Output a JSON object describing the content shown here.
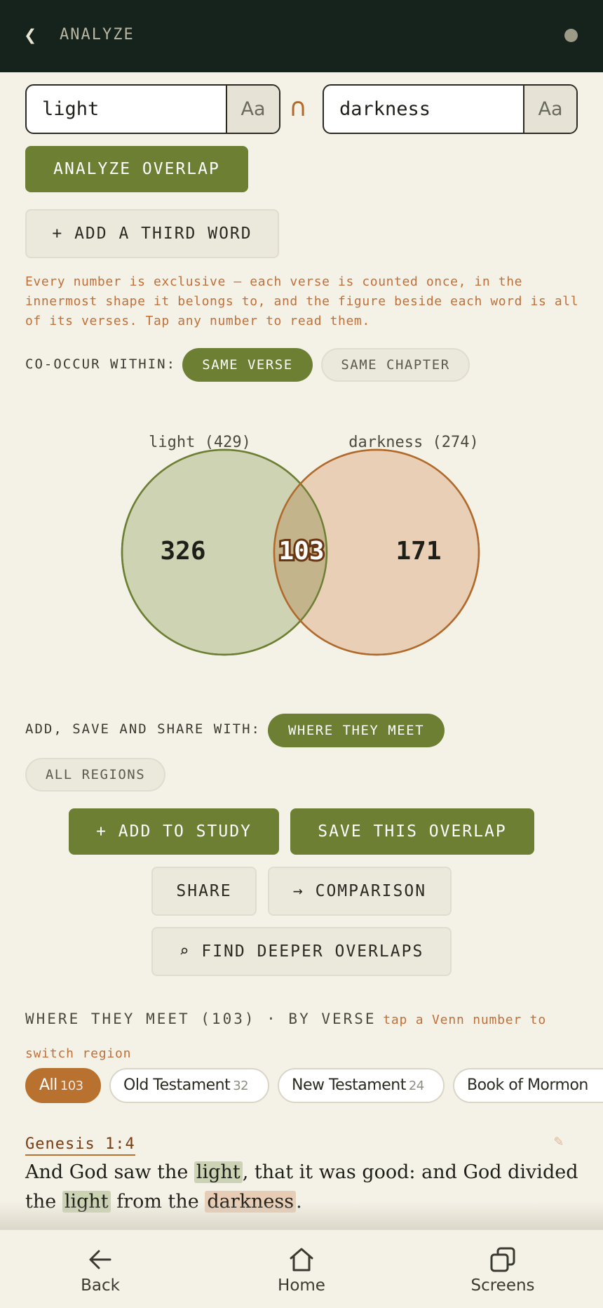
{
  "topbar": {
    "back_glyph": "❮",
    "title": "ANALYZE"
  },
  "words": {
    "a": "light",
    "b": "darkness",
    "case_label": "Aa",
    "intersect_symbol": "∩"
  },
  "actions": {
    "analyze": "ANALYZE OVERLAP",
    "add_third": "+ ADD A THIRD WORD"
  },
  "note": "Every number is exclusive — each verse is counted once, in the innermost shape it belongs to, and the figure beside each word is all of its verses. Tap any number to read them.",
  "cooccur": {
    "label": "CO-OCCUR WITHIN:",
    "options": [
      "SAME VERSE",
      "SAME CHAPTER"
    ],
    "selected": "SAME VERSE"
  },
  "venn": {
    "label_a": "light (429)",
    "label_b": "darkness (274)",
    "only_a": "326",
    "both": "103",
    "only_b": "171",
    "colors": {
      "a_fill": "#cdd3b3",
      "a_stroke": "#6c7f33",
      "b_fill": "#e8cfb6",
      "b_stroke": "#b26a2c",
      "overlap_fill": "#c3b48c"
    }
  },
  "share": {
    "label": "ADD, SAVE AND SHARE WITH:",
    "options": [
      "WHERE THEY MEET",
      "ALL REGIONS"
    ],
    "selected": "WHERE THEY MEET",
    "add_to_study": "+ ADD TO STUDY",
    "save_overlap": "SAVE THIS OVERLAP",
    "share_btn": "SHARE",
    "comparison": "→ COMPARISON",
    "find_deeper": "⌕ FIND DEEPER OVERLAPS"
  },
  "results": {
    "heading": "WHERE THEY MEET (103) · BY VERSE",
    "hint": "tap a Venn number to switch region",
    "filters": [
      {
        "label": "All",
        "count": "103"
      },
      {
        "label": "Old Testament",
        "count": "32"
      },
      {
        "label": "New Testament",
        "count": "24"
      },
      {
        "label": "Book of Mormon",
        "count": ""
      }
    ],
    "verse": {
      "reference": "Genesis 1:4",
      "t1": "And God saw the ",
      "w1": "light",
      "t2": ", that it was good: and God divided the ",
      "w2": "light",
      "t3": " from the ",
      "w3": "darkness",
      "t4": "."
    }
  },
  "nav": {
    "back": "Back",
    "home": "Home",
    "screens": "Screens"
  }
}
